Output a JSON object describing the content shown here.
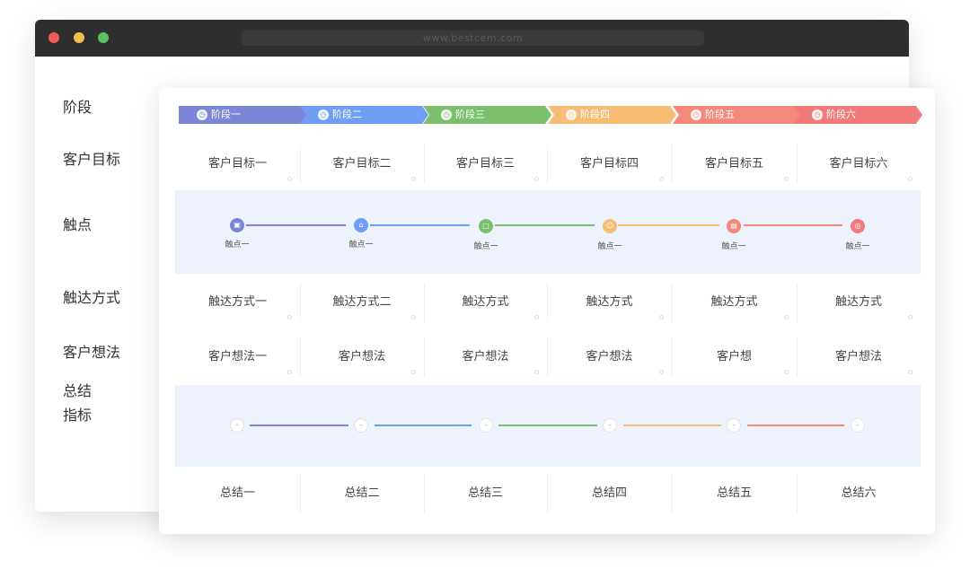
{
  "browser": {
    "url": "www.bestcem.com"
  },
  "row_labels": {
    "stage": "阶段",
    "customer_goal": "客户目标",
    "touchpoint": "触点",
    "reach_method": "触达方式",
    "customer_thought": "客户想法",
    "summary_line1": "总结",
    "summary_line2": "指标"
  },
  "stages": [
    {
      "label": "阶段一",
      "color": "#7b86d4",
      "icon": "clock-icon"
    },
    {
      "label": "阶段二",
      "color": "#6f9ff5",
      "icon": "clock-icon"
    },
    {
      "label": "阶段三",
      "color": "#79bf6c",
      "icon": "clock-icon"
    },
    {
      "label": "阶段四",
      "color": "#f7bd74",
      "icon": "clock-icon"
    },
    {
      "label": "阶段五",
      "color": "#f3897a",
      "icon": "clock-icon"
    },
    {
      "label": "阶段六",
      "color": "#f37a7a",
      "icon": "clock-icon"
    }
  ],
  "customer_goals": [
    "客户目标一",
    "客户目标二",
    "客户目标三",
    "客户目标四",
    "客户目标五",
    "客户目标六"
  ],
  "touchpoints": [
    {
      "label": "触点一",
      "color": "#7b86d4",
      "icon": "store-icon"
    },
    {
      "label": "触点一",
      "color": "#6f9ff5",
      "icon": "bank-icon"
    },
    {
      "label": "触点一",
      "color": "#79bf6c",
      "icon": "chat-icon"
    },
    {
      "label": "触点一",
      "color": "#f7bd74",
      "icon": "smile-icon"
    },
    {
      "label": "触点一",
      "color": "#f3897a",
      "icon": "document-icon"
    },
    {
      "label": "触点一",
      "color": "#f37a7a",
      "icon": "target-icon"
    }
  ],
  "reach_methods": [
    "触达方式一",
    "触达方式二",
    "触达方式",
    "触达方式",
    "触达方式",
    "触达方式"
  ],
  "customer_thoughts": [
    "客户想法一",
    "客户想法",
    "客户想法",
    "客户想法",
    "客户想",
    "客户想法"
  ],
  "summaries": [
    "总结一",
    "总结二",
    "总结三",
    "总结四",
    "总结五",
    "总结六"
  ]
}
